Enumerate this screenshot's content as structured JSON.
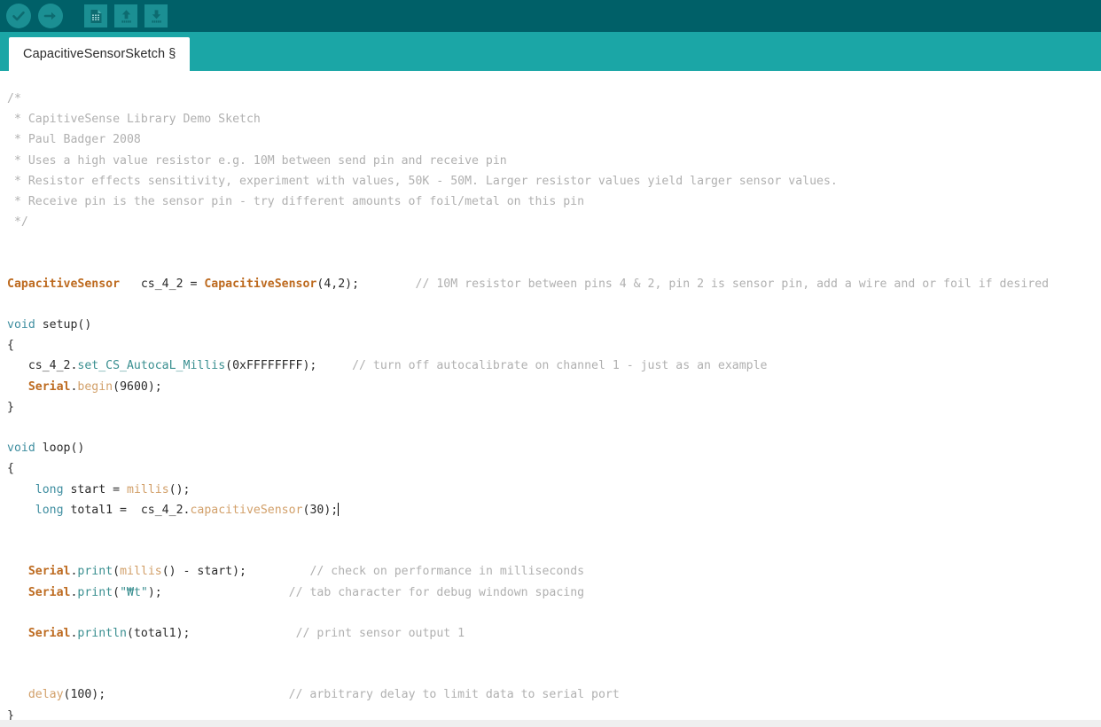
{
  "toolbar": {
    "buttons": [
      {
        "name": "verify-button",
        "icon": "check-circle-icon",
        "label": "Verify"
      },
      {
        "name": "upload-button",
        "icon": "arrow-right-circle-icon",
        "label": "Upload"
      },
      {
        "name": "new-button",
        "icon": "new-document-icon",
        "label": "New"
      },
      {
        "name": "open-button",
        "icon": "up-arrow-icon",
        "label": "Open"
      },
      {
        "name": "save-button",
        "icon": "down-arrow-icon",
        "label": "Save"
      }
    ]
  },
  "tabs": [
    {
      "label": "CapacitiveSensorSketch §",
      "active": true
    }
  ],
  "editor": {
    "caret_line": 20,
    "lines": [
      {
        "i": 0,
        "tokens": [
          {
            "t": "/*",
            "c": "cmt"
          }
        ]
      },
      {
        "i": 1,
        "tokens": [
          {
            "t": " * CapitiveSense Library Demo Sketch",
            "c": "cmt"
          }
        ]
      },
      {
        "i": 2,
        "tokens": [
          {
            "t": " * Paul Badger 2008",
            "c": "cmt"
          }
        ]
      },
      {
        "i": 3,
        "tokens": [
          {
            "t": " * Uses a high value resistor e.g. 10M between send pin and receive pin",
            "c": "cmt"
          }
        ]
      },
      {
        "i": 4,
        "tokens": [
          {
            "t": " * Resistor effects sensitivity, experiment with values, 50K - 50M. Larger resistor values yield larger sensor values.",
            "c": "cmt"
          }
        ]
      },
      {
        "i": 5,
        "tokens": [
          {
            "t": " * Receive pin is the sensor pin - try different amounts of foil/metal on this pin",
            "c": "cmt"
          }
        ]
      },
      {
        "i": 6,
        "tokens": [
          {
            "t": " */",
            "c": "cmt"
          }
        ]
      },
      {
        "i": 7,
        "tokens": []
      },
      {
        "i": 8,
        "tokens": []
      },
      {
        "i": 9,
        "tokens": [
          {
            "t": "CapacitiveSensor",
            "c": "kw1"
          },
          {
            "t": "   cs_4_2 = ",
            "c": "plain"
          },
          {
            "t": "CapacitiveSensor",
            "c": "kw1"
          },
          {
            "t": "(4,2);",
            "c": "plain"
          },
          {
            "t": "        ",
            "c": "plain"
          },
          {
            "t": "// 10M resistor between pins 4 & 2, pin 2 is sensor pin, add a wire and or foil if desired",
            "c": "cmt"
          }
        ]
      },
      {
        "i": 10,
        "tokens": []
      },
      {
        "i": 11,
        "tokens": [
          {
            "t": "void",
            "c": "kw2"
          },
          {
            "t": " setup()",
            "c": "plain"
          }
        ]
      },
      {
        "i": 12,
        "tokens": [
          {
            "t": "{",
            "c": "plain"
          }
        ]
      },
      {
        "i": 13,
        "tokens": [
          {
            "t": "   cs_4_2.",
            "c": "plain"
          },
          {
            "t": "set_CS_AutocaL_Millis",
            "c": "fn"
          },
          {
            "t": "(0xFFFFFFFF);",
            "c": "plain"
          },
          {
            "t": "     ",
            "c": "plain"
          },
          {
            "t": "// turn off autocalibrate on channel 1 - just as an example",
            "c": "cmt"
          }
        ]
      },
      {
        "i": 14,
        "tokens": [
          {
            "t": "   ",
            "c": "plain"
          },
          {
            "t": "Serial",
            "c": "kw1"
          },
          {
            "t": ".",
            "c": "plain"
          },
          {
            "t": "begin",
            "c": "fn2"
          },
          {
            "t": "(9600);",
            "c": "plain"
          }
        ]
      },
      {
        "i": 15,
        "tokens": [
          {
            "t": "}",
            "c": "plain"
          }
        ]
      },
      {
        "i": 16,
        "tokens": []
      },
      {
        "i": 17,
        "tokens": [
          {
            "t": "void",
            "c": "kw2"
          },
          {
            "t": " loop()",
            "c": "plain"
          }
        ]
      },
      {
        "i": 18,
        "tokens": [
          {
            "t": "{",
            "c": "plain"
          }
        ]
      },
      {
        "i": 19,
        "tokens": [
          {
            "t": "    ",
            "c": "plain"
          },
          {
            "t": "long",
            "c": "kw2"
          },
          {
            "t": " start = ",
            "c": "plain"
          },
          {
            "t": "millis",
            "c": "fn2"
          },
          {
            "t": "();",
            "c": "plain"
          }
        ]
      },
      {
        "i": 20,
        "tokens": [
          {
            "t": "    ",
            "c": "plain"
          },
          {
            "t": "long",
            "c": "kw2"
          },
          {
            "t": " total1 =  cs_4_2.",
            "c": "plain"
          },
          {
            "t": "capacitiveSensor",
            "c": "fn2"
          },
          {
            "t": "(30);",
            "c": "plain"
          }
        ],
        "caret": true
      },
      {
        "i": 21,
        "tokens": []
      },
      {
        "i": 22,
        "tokens": []
      },
      {
        "i": 23,
        "tokens": [
          {
            "t": "   ",
            "c": "plain"
          },
          {
            "t": "Serial",
            "c": "kw1"
          },
          {
            "t": ".",
            "c": "plain"
          },
          {
            "t": "print",
            "c": "fn"
          },
          {
            "t": "(",
            "c": "plain"
          },
          {
            "t": "millis",
            "c": "fn2"
          },
          {
            "t": "() - start);",
            "c": "plain"
          },
          {
            "t": "         ",
            "c": "plain"
          },
          {
            "t": "// check on performance in milliseconds",
            "c": "cmt"
          }
        ]
      },
      {
        "i": 24,
        "tokens": [
          {
            "t": "   ",
            "c": "plain"
          },
          {
            "t": "Serial",
            "c": "kw1"
          },
          {
            "t": ".",
            "c": "plain"
          },
          {
            "t": "print",
            "c": "fn"
          },
          {
            "t": "(",
            "c": "plain"
          },
          {
            "t": "\"₩t\"",
            "c": "str"
          },
          {
            "t": ");",
            "c": "plain"
          },
          {
            "t": "                  ",
            "c": "plain"
          },
          {
            "t": "// tab character for debug windown spacing",
            "c": "cmt"
          }
        ]
      },
      {
        "i": 25,
        "tokens": []
      },
      {
        "i": 26,
        "tokens": [
          {
            "t": "   ",
            "c": "plain"
          },
          {
            "t": "Serial",
            "c": "kw1"
          },
          {
            "t": ".",
            "c": "plain"
          },
          {
            "t": "println",
            "c": "fn"
          },
          {
            "t": "(total1);",
            "c": "plain"
          },
          {
            "t": "               ",
            "c": "plain"
          },
          {
            "t": "// print sensor output 1",
            "c": "cmt"
          }
        ]
      },
      {
        "i": 27,
        "tokens": []
      },
      {
        "i": 28,
        "tokens": []
      },
      {
        "i": 29,
        "tokens": [
          {
            "t": "   ",
            "c": "plain"
          },
          {
            "t": "delay",
            "c": "fn2"
          },
          {
            "t": "(100);",
            "c": "plain"
          },
          {
            "t": "                          ",
            "c": "plain"
          },
          {
            "t": "// arbitrary delay to limit data to serial port",
            "c": "cmt"
          }
        ]
      },
      {
        "i": 30,
        "tokens": [
          {
            "t": "}",
            "c": "plain"
          }
        ]
      }
    ]
  },
  "colors": {
    "toolbar_bg": "#006068",
    "tabbar_bg": "#1ba6a6",
    "icon_bg": "#1b8f93",
    "icon_fg": "#0d6b70",
    "editor_bg": "#ffffff",
    "comment": "#b0b0b0",
    "keyword": "#3f8ea0",
    "library": "#bd6a1f",
    "function": "#3a8f90",
    "builtin": "#d2a06a",
    "text": "#2b2b2b"
  }
}
